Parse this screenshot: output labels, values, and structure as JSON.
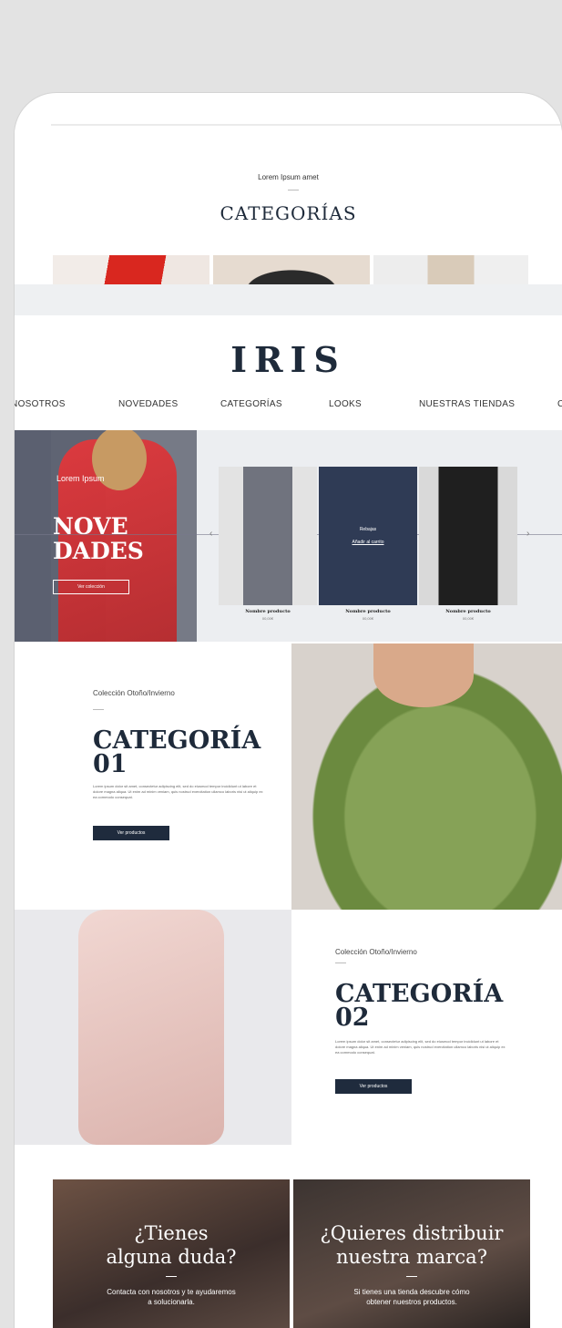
{
  "categories_preview": {
    "subtitle": "Lorem Ipsum amet",
    "title": "CATEGORÍAS"
  },
  "logo": "IRIS",
  "nav": [
    "E NOSOTROS",
    "NOVEDADES",
    "CATEGORÍAS",
    "LOOKS",
    "NUESTRAS TIENDAS",
    "C"
  ],
  "novedades": {
    "subtitle": "Lorem Ipsum",
    "title": "NOVE\nDADES",
    "button": "Ver colección",
    "products": [
      {
        "name": "Nombre producto",
        "price": "00,00€"
      },
      {
        "name": "Nombre producto",
        "price": "00,00€"
      },
      {
        "name": "Nombre producto",
        "price": "00,00€"
      }
    ],
    "overlay_title": "Rebajas",
    "overlay_link": "Añadir al carrito"
  },
  "category1": {
    "collection": "Colección Otoño/Invierno",
    "title": "CATEGORÍA\n01",
    "text": "Lorem ipsum dolor sit amet, consectetur adipiscing elit, sed do eiusmod tempor incididunt ut labore et dolore magna aliqua. Ut enim ad minim veniam, quis nostrud exercitation ullamco laboris nisi ut aliquip ex ea commodo consequat.",
    "button": "Ver productos"
  },
  "category2": {
    "collection": "Colección Otoño/Invierno",
    "title": "CATEGORÍA\n02",
    "text": "Lorem ipsum dolor sit amet, consectetur adipiscing elit, sed do eiusmod tempor incididunt ut labore et dolore magna aliqua. Ut enim ad minim veniam, quis nostrud exercitation ullamco laboris nisi ut aliquip ex ea commodo consequat.",
    "button": "Ver productos"
  },
  "promos": [
    {
      "title": "¿Tienes\nalguna duda?",
      "text": "Contacta con nosotros y te ayudaremos\na solucionarla."
    },
    {
      "title": "¿Quieres distribuir\nnuestra marca?",
      "text": "Si tienes una tienda descubre cómo\nobtener nuestros productos."
    }
  ]
}
